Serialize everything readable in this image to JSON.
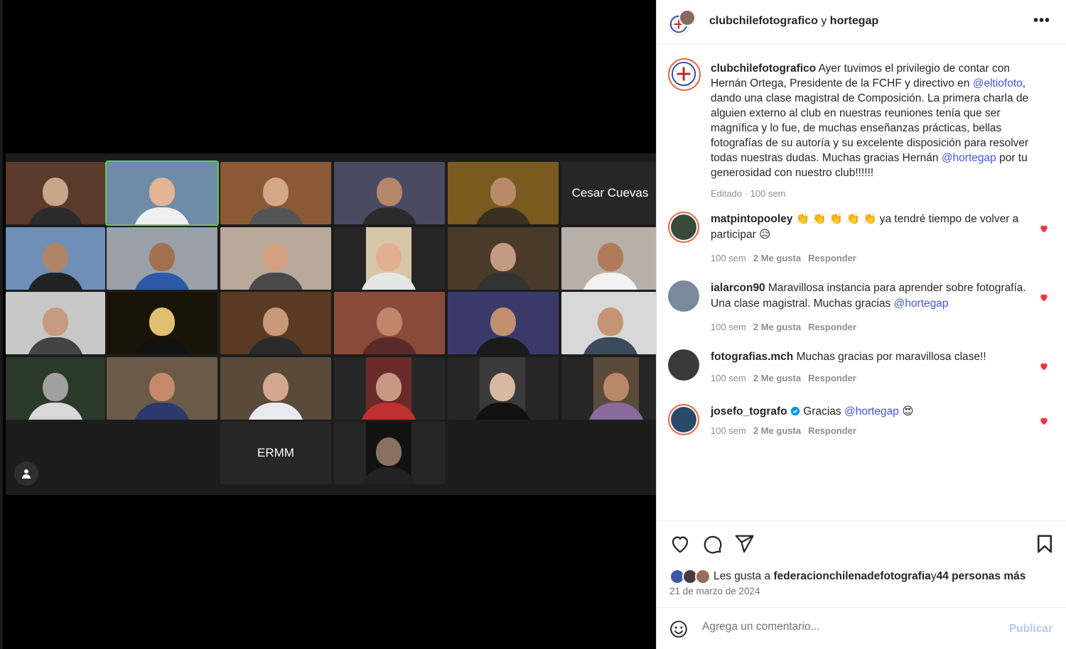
{
  "video": {
    "tiles": [
      {
        "row": 0,
        "col": 0,
        "bg": "#5a3a2a",
        "skin": "#c9a58a",
        "shirt": "#2b2b2b"
      },
      {
        "row": 0,
        "col": 1,
        "bg": "#6e8ca8",
        "skin": "#e4b494",
        "shirt": "#f0f0f0",
        "active": true
      },
      {
        "row": 0,
        "col": 2,
        "bg": "#8a5a36",
        "skin": "#d4a68a",
        "shirt": "#555555"
      },
      {
        "row": 0,
        "col": 3,
        "bg": "#4a4a62",
        "skin": "#b5856c",
        "shirt": "#2a2a2a"
      },
      {
        "row": 0,
        "col": 4,
        "bg": "#7a5a1e",
        "skin": "#b88a6a",
        "shirt": "#3a3020"
      },
      {
        "row": 0,
        "col": 5,
        "name": "Cesar Cuevas"
      },
      {
        "row": 1,
        "col": 0,
        "bg": "#6f8fb8",
        "skin": "#b08466",
        "shirt": "#222222"
      },
      {
        "row": 1,
        "col": 1,
        "bg": "#9aa0a8",
        "skin": "#a07050",
        "shirt": "#2c5aa8"
      },
      {
        "row": 1,
        "col": 2,
        "bg": "#b8a89a",
        "skin": "#d0a080",
        "shirt": "#4a4a4a"
      },
      {
        "row": 1,
        "col": 3,
        "bg": "#d8c6a8",
        "skin": "#e2b090",
        "shirt": "#e6e6e6",
        "narrow": true
      },
      {
        "row": 1,
        "col": 4,
        "bg": "#4a3a2a",
        "skin": "#c49a80",
        "shirt": "#333333"
      },
      {
        "row": 1,
        "col": 5,
        "bg": "#b8b0a8",
        "skin": "#b07a58",
        "shirt": "#f2f2f2"
      },
      {
        "row": 2,
        "col": 0,
        "bg": "#c8c8c8",
        "skin": "#c89a80",
        "shirt": "#444444"
      },
      {
        "row": 2,
        "col": 1,
        "bg": "#1a1408",
        "skin": "#e0c070",
        "shirt": "#111111"
      },
      {
        "row": 2,
        "col": 2,
        "bg": "#5a3a22",
        "skin": "#c89878",
        "shirt": "#2a2a2a"
      },
      {
        "row": 2,
        "col": 3,
        "bg": "#8a4a3a",
        "skin": "#c0866a",
        "shirt": "#5a2a2a"
      },
      {
        "row": 2,
        "col": 4,
        "bg": "#3a3a6a",
        "skin": "#c09070",
        "shirt": "#1a1a1a"
      },
      {
        "row": 2,
        "col": 5,
        "bg": "#d8d8d8",
        "skin": "#c49474",
        "shirt": "#3a4a5a"
      },
      {
        "row": 3,
        "col": 0,
        "bg": "#2a3a2a",
        "skin": "#a0a0a0",
        "shirt": "#d8d8d8"
      },
      {
        "row": 3,
        "col": 1,
        "bg": "#6a5a4a",
        "skin": "#c48a6a",
        "shirt": "#2a3a6a"
      },
      {
        "row": 3,
        "col": 2,
        "bg": "#5a4a3a",
        "skin": "#d4a890",
        "shirt": "#e8eaf0"
      },
      {
        "row": 3,
        "col": 3,
        "bg": "#6a2a2a",
        "skin": "#c89880",
        "shirt": "#c03030",
        "narrow": true
      },
      {
        "row": 3,
        "col": 4,
        "bg": "#3a3a3a",
        "skin": "#d8b8a0",
        "shirt": "#111111",
        "narrow": true
      },
      {
        "row": 3,
        "col": 5,
        "bg": "#5a4a3a",
        "skin": "#b88868",
        "shirt": "#8a6a9a",
        "narrow": true
      },
      {
        "row": 4,
        "col": 2,
        "name": "ERMM"
      },
      {
        "row": 4,
        "col": 3,
        "bg": "#111111",
        "skin": "#8a7060",
        "shirt": "#222222",
        "narrow": true
      }
    ]
  },
  "header": {
    "user1": "clubchilefotografico",
    "joiner": " y ",
    "user2": "hortegap",
    "more": "•••"
  },
  "caption": {
    "username": "clubchilefotografico",
    "text1": " Ayer tuvimos el privilegio de contar con Hernán Ortega, Presidente de la FCHF y directivo en ",
    "mention1": "@eltiofoto",
    "text2": ", dando una clase magistral de Composición. La primera charla de alguien externo al club en nuestras reuniones tenía que ser magnífica y lo fue, de muchas enseñanzas prácticas, bellas fotografías de su autoría y su excelente disposición para resolver todas nuestras dudas. Muchas gracias Hernán ",
    "mention2": "@hortegap",
    "text3": " por tu generosidad con nuestro club!!!!!!",
    "meta": "Editado · 100 sem"
  },
  "comments": [
    {
      "user": "matpintopooley",
      "text": " 👏 👏 👏 👏 👏  ya tendré tiempo de volver a participar 😥",
      "time": "100 sem",
      "likes": "2 Me gusta",
      "reply": "Responder",
      "avatar": "#3a4a3a"
    },
    {
      "user": "ialarcon90",
      "text": " Maravillosa instancia para aprender sobre fotografía. Una clase magistral. Muchas gracias ",
      "mention": "@hortegap",
      "time": "100 sem",
      "likes": "2 Me gusta",
      "reply": "Responder",
      "avatar": "#7a8a9a"
    },
    {
      "user": "fotografias.mch",
      "text": " Muchas gracias por maravillosa clase!!",
      "time": "100 sem",
      "likes": "2 Me gusta",
      "reply": "Responder",
      "avatar": "#3a3a3a"
    },
    {
      "user": "josefo_tografo",
      "text": " Gracias ",
      "mention": "@hortegap",
      "emoji": " 😍",
      "time": "100 sem",
      "likes": "2 Me gusta",
      "reply": "Responder",
      "avatar": "#2a4a6a",
      "verified": true
    }
  ],
  "likes": {
    "prefix": "Les gusta a ",
    "user": "federacionchilenadefotografia",
    "middle": " y ",
    "others": "44 personas más"
  },
  "date": "21 de marzo de 2024",
  "add_comment": {
    "placeholder": "Agrega un comentario...",
    "publish": "Publicar"
  },
  "colors": {
    "mention": "#4150f7",
    "heart": "#ff3040",
    "publish_disabled": "#b3c8f8"
  }
}
